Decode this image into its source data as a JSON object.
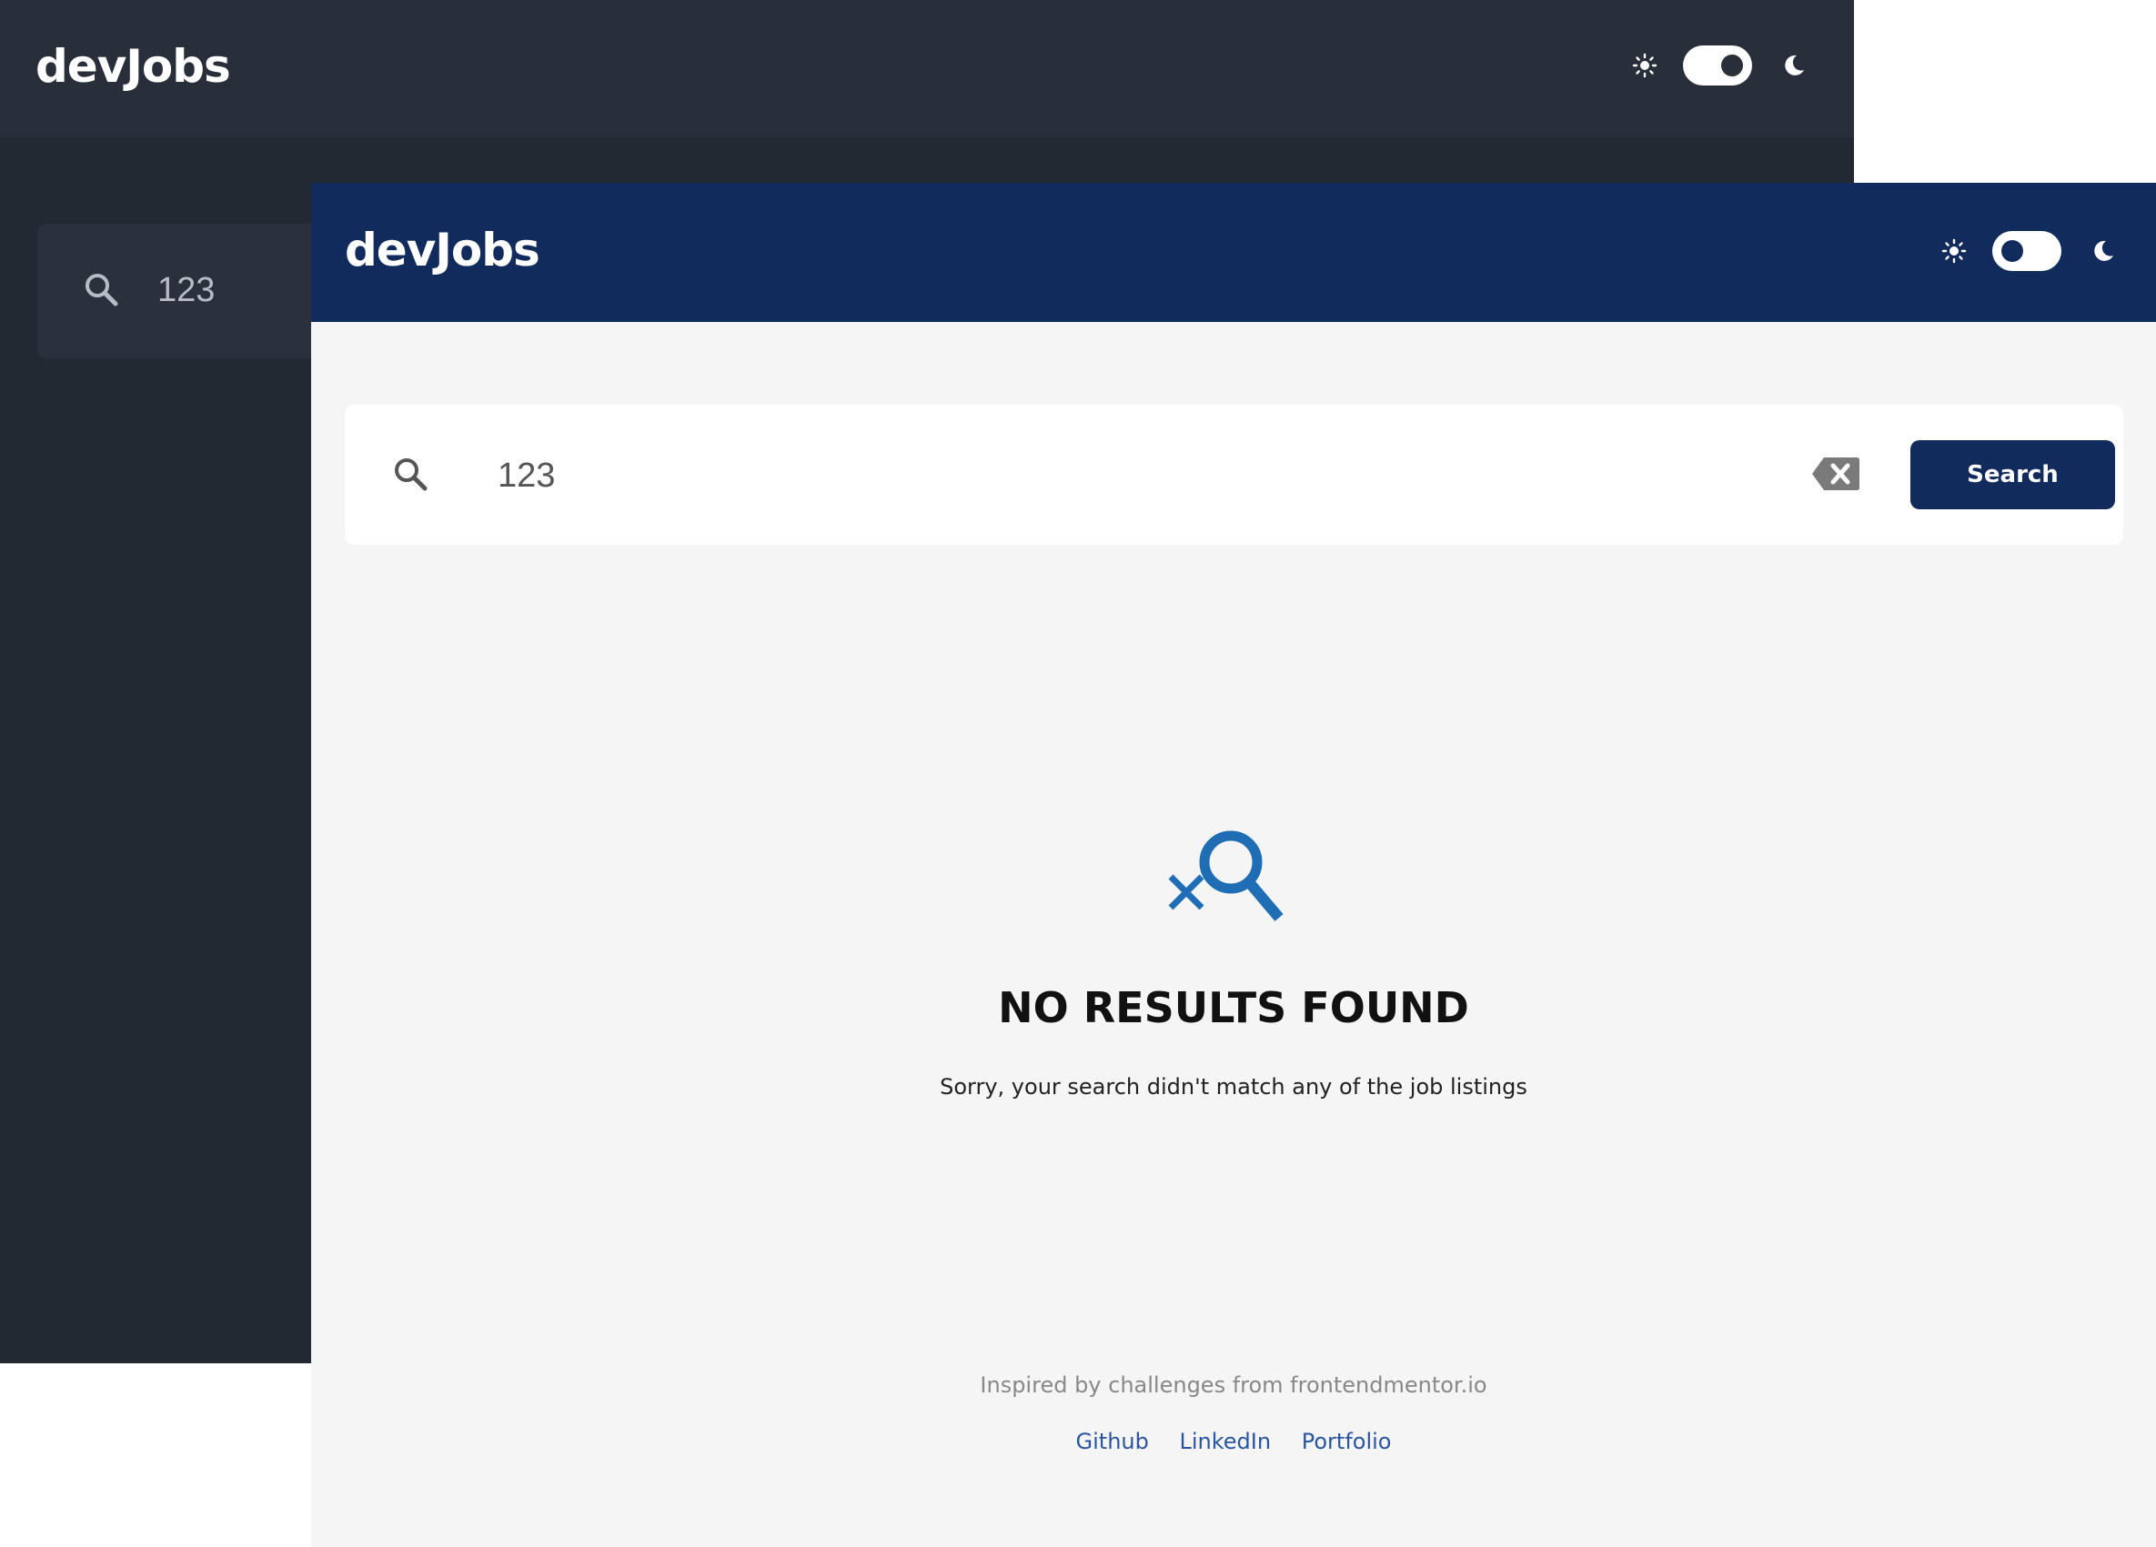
{
  "brand": {
    "logo": "devJobs"
  },
  "theme_toggle": {
    "light_icon": "sun-icon",
    "dark_icon": "moon-icon"
  },
  "dark_window": {
    "search": {
      "value": "123",
      "icon": "search-icon"
    },
    "colors": {
      "header": "#292f3a",
      "background": "#232933"
    }
  },
  "light_window": {
    "search": {
      "value": "123",
      "icon": "search-icon",
      "clear_icon": "backspace-clear-icon",
      "button_label": "Search"
    },
    "empty_state": {
      "icon": "search-not-found-icon",
      "title": "NO RESULTS FOUND",
      "message": "Sorry, your search didn't match any of the job listings"
    },
    "footer": {
      "credit": "Inspired by challenges from frontendmentor.io",
      "links": [
        "Github",
        "LinkedIn",
        "Portfolio"
      ]
    },
    "colors": {
      "header": "#112b5c",
      "accent": "#1f6db5",
      "background": "#f5f5f5"
    }
  }
}
